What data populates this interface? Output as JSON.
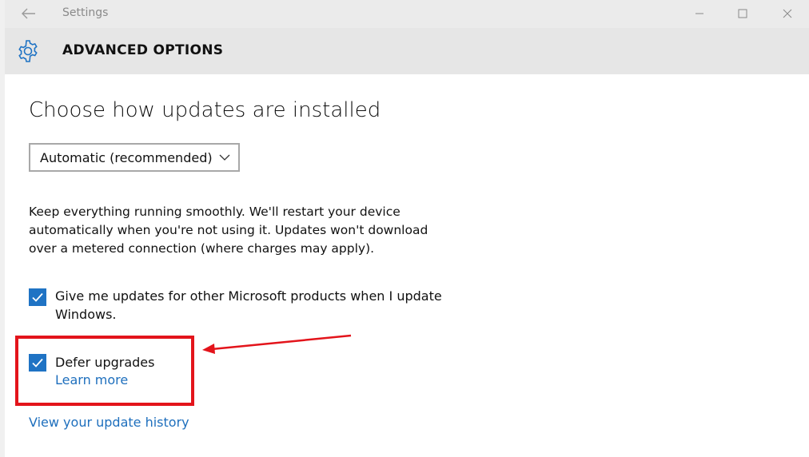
{
  "window": {
    "title": "Settings",
    "icons": {
      "back": "back-arrow-icon",
      "minimize": "minimize-icon",
      "maximize": "maximize-icon",
      "close": "close-icon"
    }
  },
  "header": {
    "title": "ADVANCED OPTIONS",
    "icon": "gear-icon"
  },
  "main": {
    "section_title": "Choose how updates are installed",
    "install_mode": {
      "selected": "Automatic (recommended)",
      "icon": "chevron-down-icon"
    },
    "description": "Keep everything running smoothly. We'll restart your device automatically when you're not using it. Updates won't download over a metered connection (where charges may apply).",
    "options": [
      {
        "label": "Give me updates for other Microsoft products when I update Windows.",
        "checked": true
      },
      {
        "label": "Defer upgrades",
        "checked": true,
        "link": "Learn more"
      }
    ],
    "history_link": "View your update history"
  },
  "annotation": {
    "highlight_color": "#e3141b"
  },
  "colors": {
    "accent": "#1f73c4",
    "link": "#1e6fbd",
    "titlebar_bg": "#ebebeb",
    "header_bg": "#e6e6e6"
  }
}
